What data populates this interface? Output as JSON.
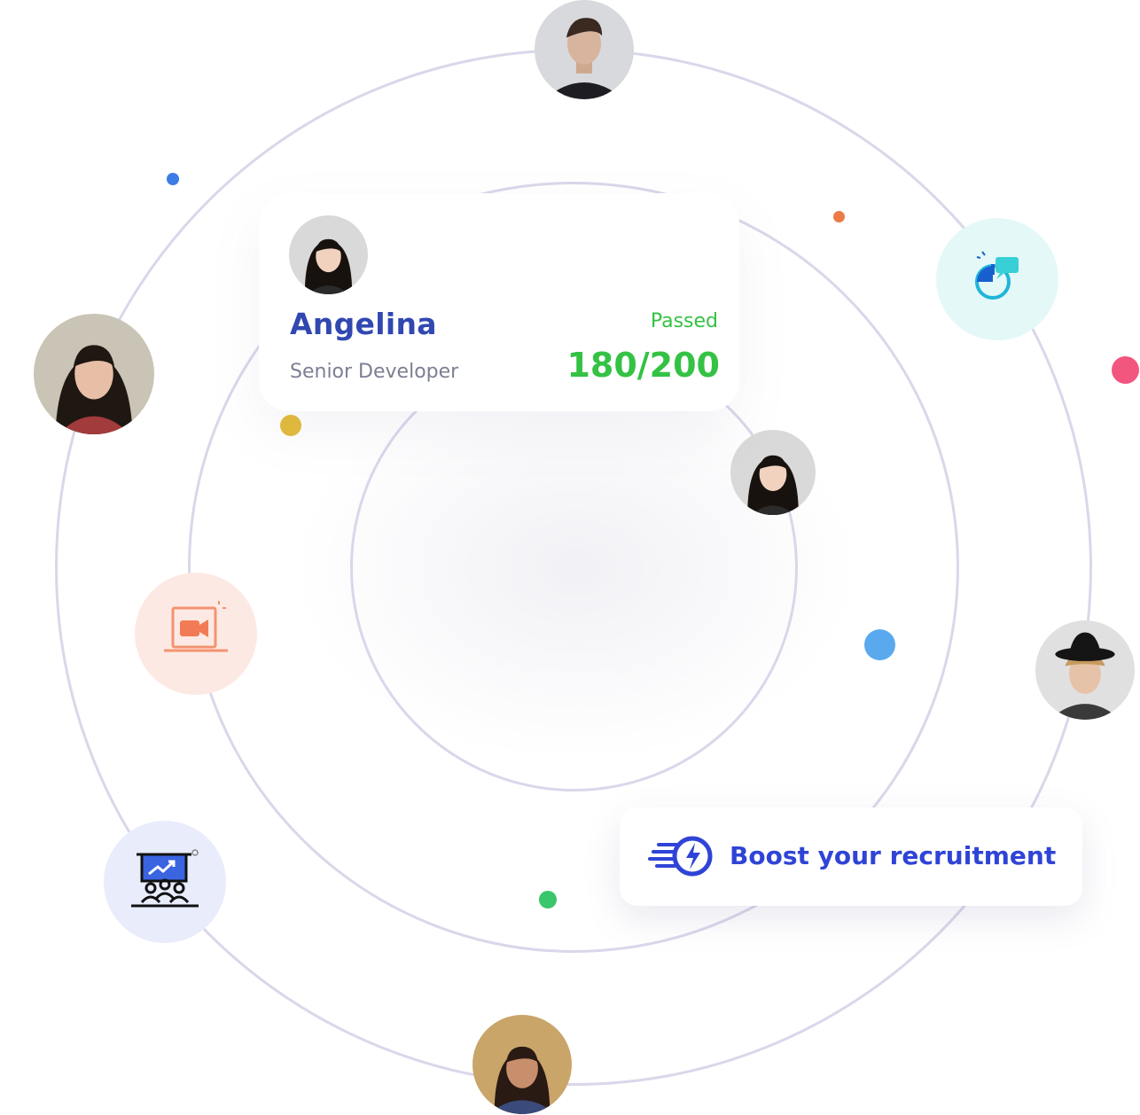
{
  "profile_card": {
    "name": "Angelina",
    "role": "Senior Developer",
    "status": "Passed",
    "score": "180/200"
  },
  "boost_banner": {
    "label": "Boost your recruitment",
    "icon": "fast-lightning-icon"
  },
  "avatars": [
    {
      "name": "avatar-top",
      "hair": "#3a2a22",
      "skin": "#d8b49e",
      "shirt": "#1e1e22",
      "bg": "#d7d9dc"
    },
    {
      "name": "avatar-left-woman",
      "hair": "#1f1712",
      "skin": "#e7bfa6",
      "shirt": "#a23b3b",
      "bg": "#c9c4b5"
    },
    {
      "name": "avatar-card-woman",
      "hair": "#18120f",
      "skin": "#f1d2bf",
      "shirt": "#2b2b2b",
      "bg": "#d9d9d9"
    },
    {
      "name": "avatar-orbit-woman",
      "hair": "#18120f",
      "skin": "#f1d2bf",
      "shirt": "#2b2b2b",
      "bg": "#d9d9d9"
    },
    {
      "name": "avatar-right-man-hat",
      "hair": "#c79a5e",
      "skin": "#e6c2a8",
      "shirt": "#3a3a3a",
      "bg": "#e0e0e0"
    },
    {
      "name": "avatar-bottom-woman",
      "hair": "#2a1a14",
      "skin": "#c88f6c",
      "shirt": "#3a4a7a",
      "bg": "#c9a56a"
    }
  ],
  "icons": {
    "video_call": "video-call-laptop-icon",
    "chat": "chat-bubble-icon",
    "presentation": "presentation-audience-icon"
  },
  "colors": {
    "ring": "#d9d7ea",
    "accent_blue": "#3148b0",
    "success_green": "#34c244",
    "boost_blue": "#2f44d6"
  }
}
